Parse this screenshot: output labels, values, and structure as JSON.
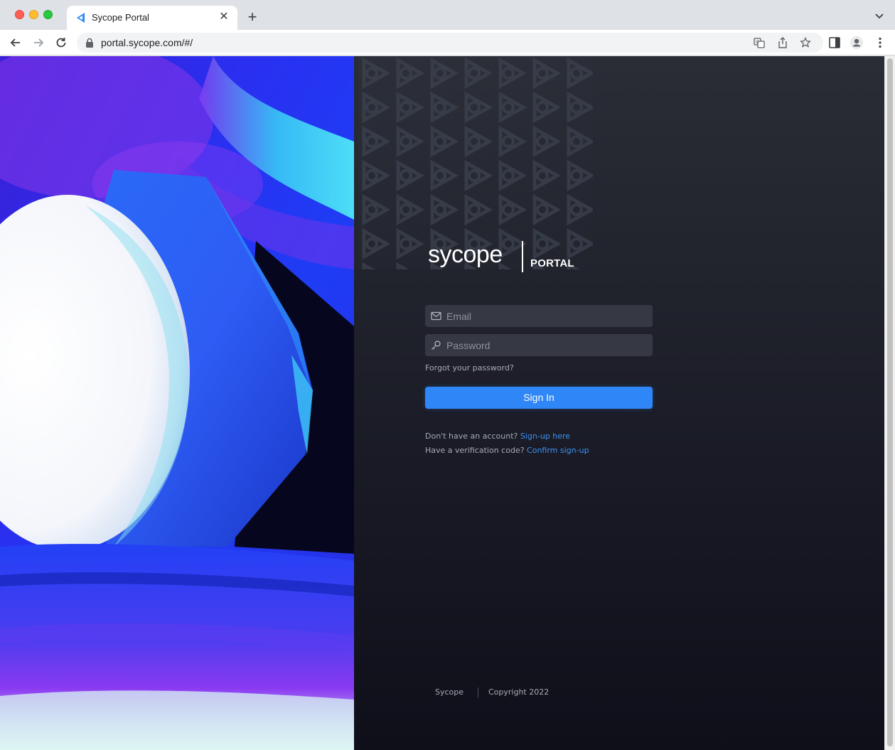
{
  "browser": {
    "tab_title": "Sycope Portal",
    "url": "portal.sycope.com/#/",
    "icons": [
      "back-icon",
      "forward-icon",
      "reload-icon",
      "lock-icon",
      "translate-icon",
      "share-icon",
      "star-icon",
      "side-panel-icon",
      "profile-icon",
      "menu-icon"
    ]
  },
  "login": {
    "logo_word": "sycope",
    "logo_portal": "PORTAL",
    "email_placeholder": "Email",
    "password_placeholder": "Password",
    "forgot_label": "Forgot your password?",
    "signin_label": "Sign In",
    "no_account_text": "Don't have an account?",
    "signup_link": "Sign-up here",
    "verification_text": "Have a verification code?",
    "confirm_link": "Confirm sign-up"
  },
  "footer": {
    "brand": "Sycope",
    "copyright": "Copyright 2022"
  },
  "colors": {
    "accent": "#2f86f6",
    "link": "#3d93f8",
    "panel_dark": "#13131d"
  }
}
